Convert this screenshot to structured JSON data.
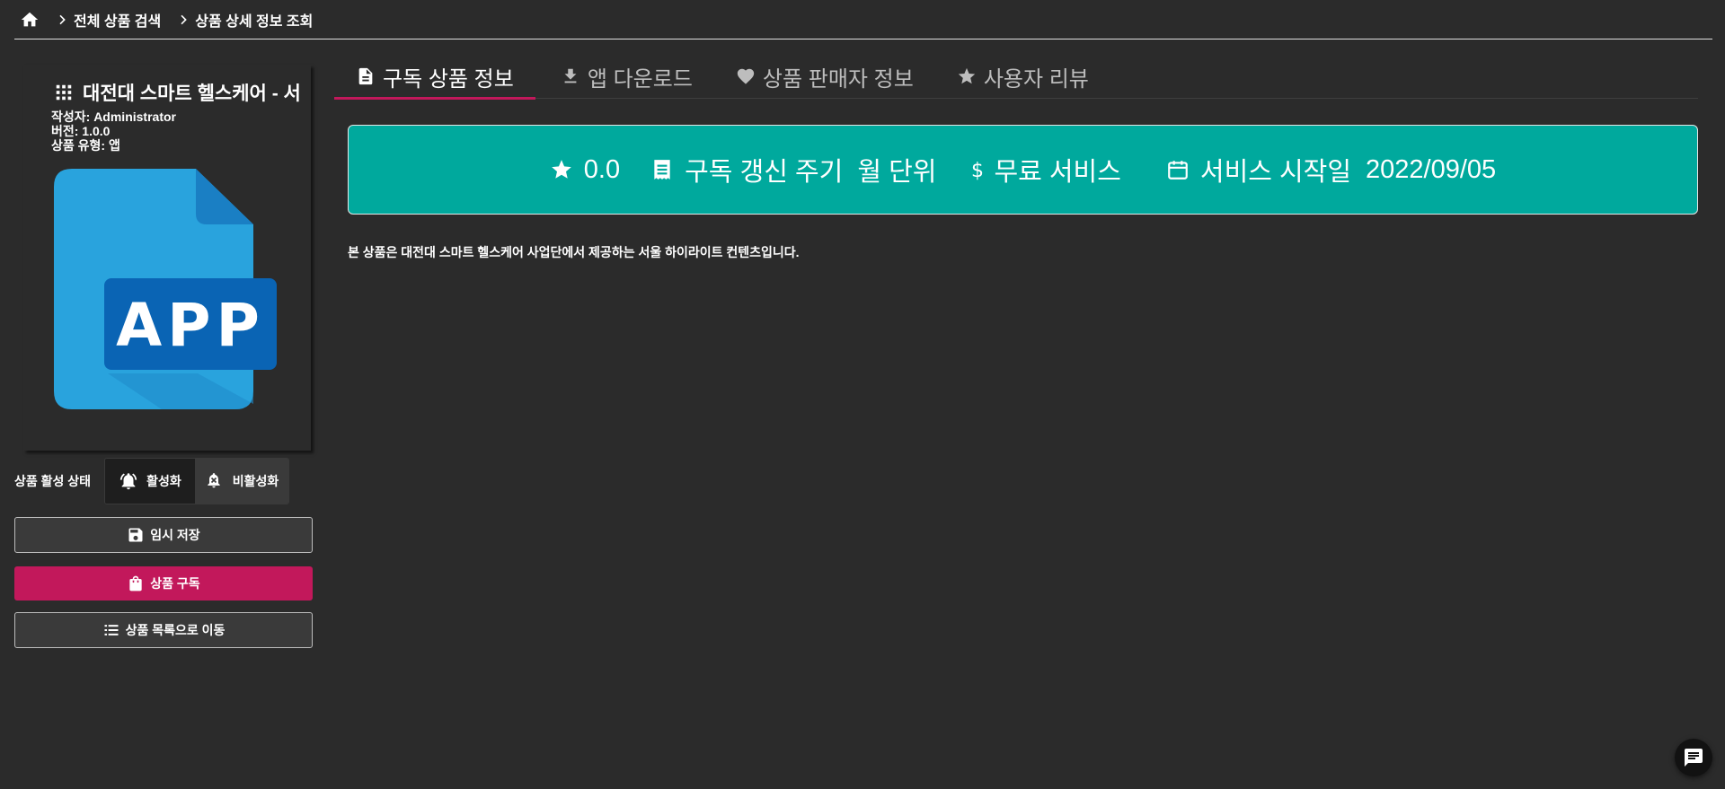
{
  "breadcrumb": {
    "items": [
      {
        "label": "전체 상품 검색"
      },
      {
        "label": "상품 상세 정보 조회"
      }
    ]
  },
  "product": {
    "title": "대전대 스마트 헬스케어 - 서",
    "author": "작성자: Administrator",
    "version": "버전: 1.0.0",
    "type": "상품 유형: 앱",
    "illustration_text": "APP"
  },
  "status": {
    "label": "상품 활성 상태",
    "active_label": "활성화",
    "inactive_label": "비활성화"
  },
  "actions": {
    "save_label": "임시 저장",
    "subscribe_label": "상품 구독",
    "list_label": "상품 목록으로 이동"
  },
  "tabs": [
    {
      "label": "구독 상품 정보",
      "icon": "document-icon",
      "active": true
    },
    {
      "label": "앱 다운로드",
      "icon": "download-icon",
      "active": false
    },
    {
      "label": "상품 판매자 정보",
      "icon": "heart-icon",
      "active": false
    },
    {
      "label": "사용자 리뷰",
      "icon": "star-icon",
      "active": false
    }
  ],
  "summary": {
    "rating": "0.0",
    "renewal_label": "구독 갱신 주기",
    "renewal_value": "월 단위",
    "price_label": "무료 서비스",
    "start_label": "서비스 시작일",
    "start_value": "2022/09/05"
  },
  "description": "본 상품은 대전대 스마트 헬스케어 사업단에서 제공하는 서울 하이라이트 컨텐츠입니다.",
  "colors": {
    "background": "#2b2b2b",
    "accent": "#c2185b",
    "banner": "#00a99d",
    "illustration_blue": "#29a3dd",
    "illustration_dark": "#0a64b4"
  }
}
